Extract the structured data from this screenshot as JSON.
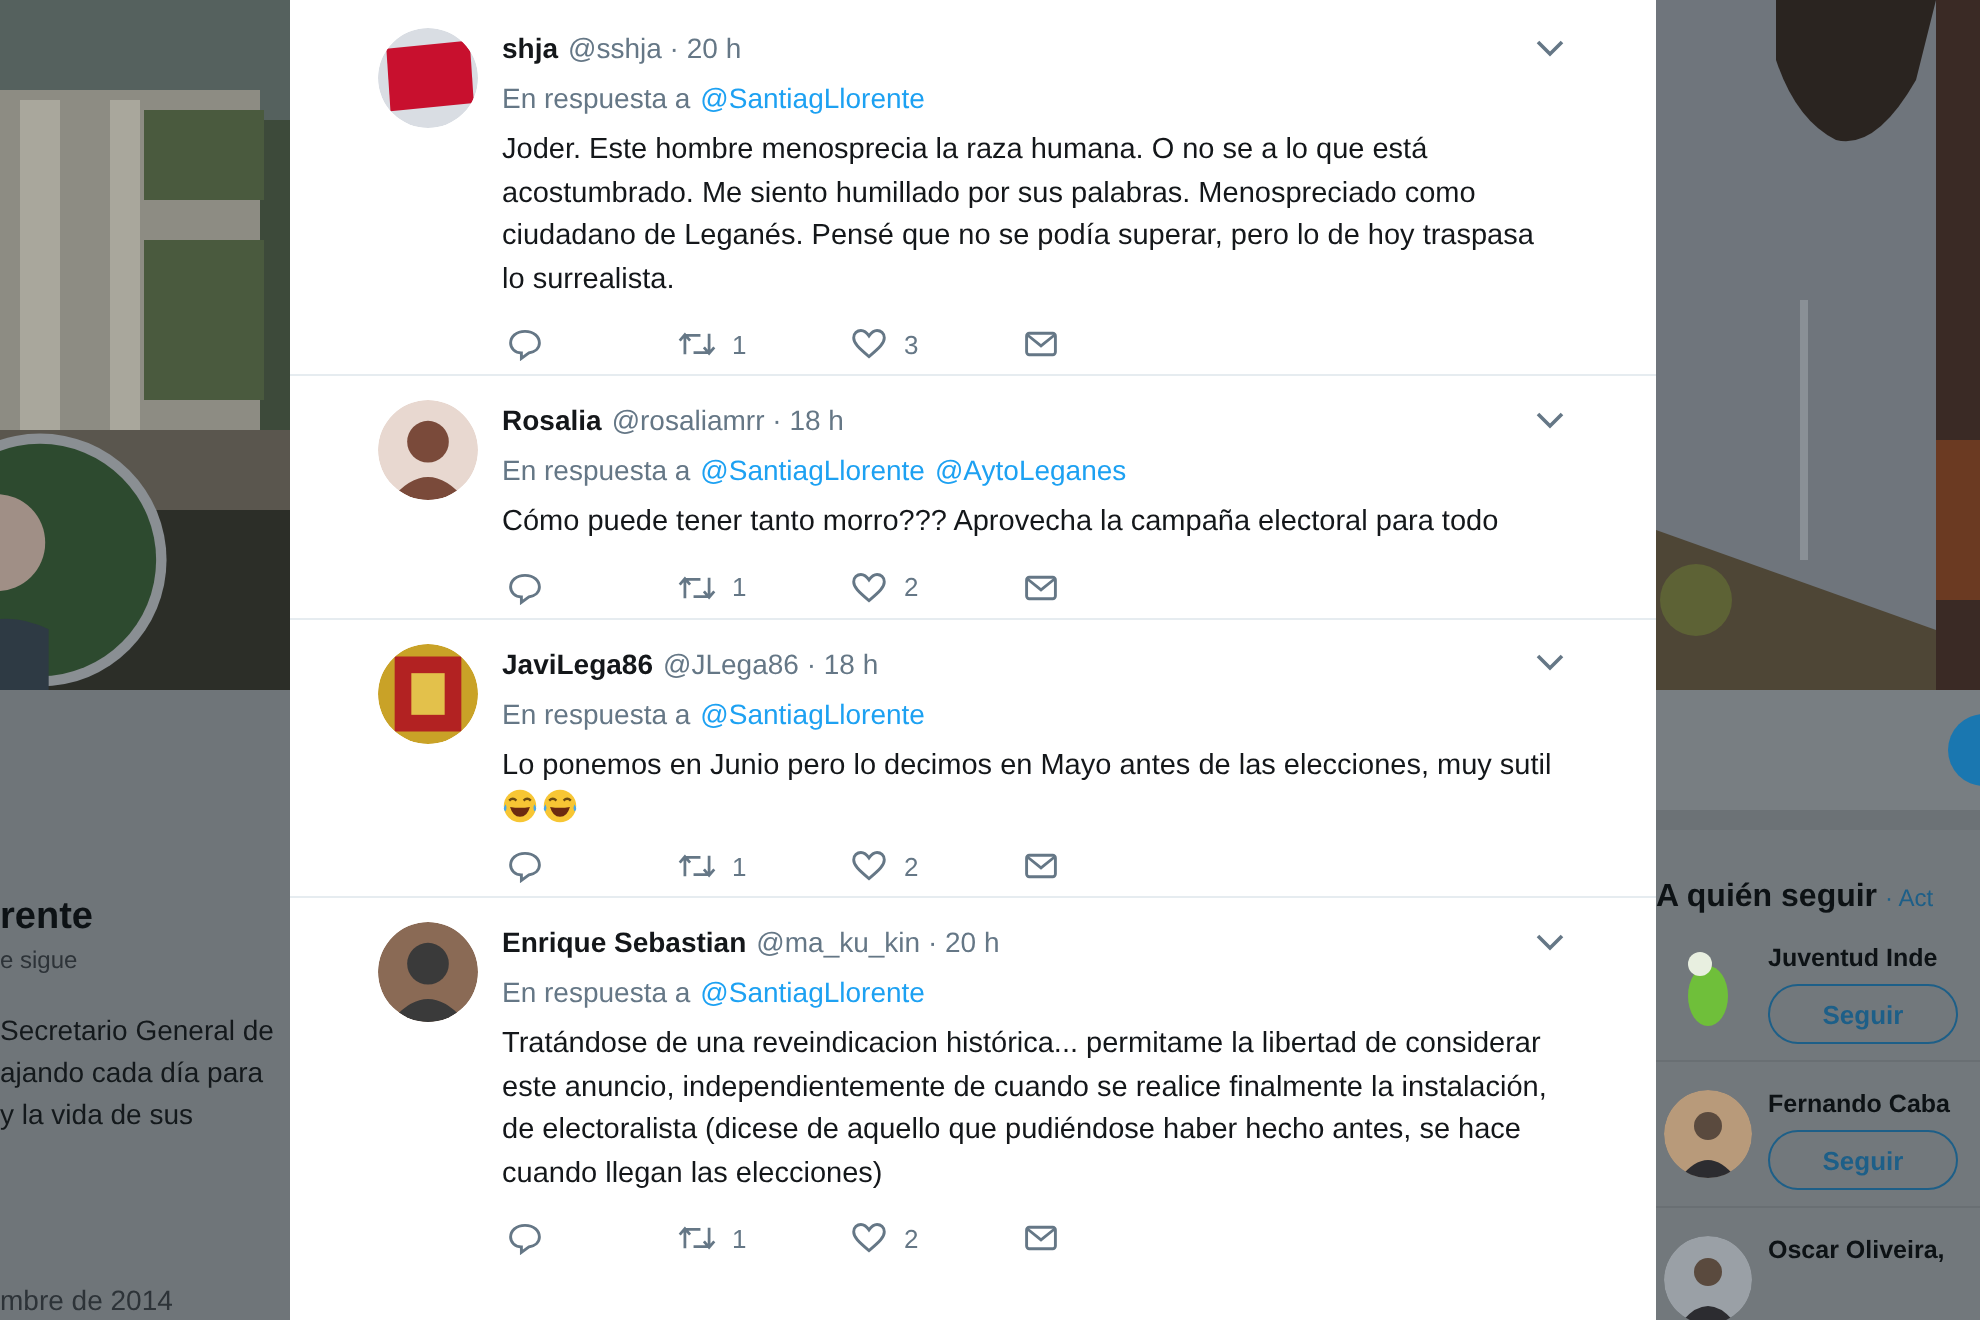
{
  "profile": {
    "name": "rente",
    "follows_you": "e sigue",
    "bio": [
      "Secretario General de",
      "ajando cada día para",
      "y la vida de sus"
    ],
    "joined": "mbre de 2014"
  },
  "replies": [
    {
      "name": "shja",
      "meta": "@sshja · 20 h",
      "reply_label": "En respuesta a",
      "mentions": [
        "@SantiagLlorente"
      ],
      "text": "Joder. Este hombre menosprecia la raza humana. O no se a lo que está acostumbrado. Me siento humillado por sus palabras. Menospreciado como ciudadano de Leganés. Pensé que no se podía superar, pero lo de hoy traspasa lo surrealista.",
      "retweets": "1",
      "likes": "3"
    },
    {
      "name": "Rosalia",
      "meta": "@rosaliamrr · 18 h",
      "reply_label": "En respuesta a",
      "mentions": [
        "@SantiagLlorente",
        "@AytoLeganes"
      ],
      "text": "Cómo puede tener tanto morro??? Aprovecha la campaña electoral para todo",
      "retweets": "1",
      "likes": "2"
    },
    {
      "name": "JaviLega86",
      "meta": "@JLega86 · 18 h",
      "reply_label": "En respuesta a",
      "mentions": [
        "@SantiagLlorente"
      ],
      "text": "Lo ponemos en Junio pero lo decimos en Mayo antes de las elecciones, muy sutil",
      "kind": "with-emoji-line",
      "retweets": "1",
      "likes": "2"
    },
    {
      "name": "Enrique Sebastian",
      "meta": "@ma_ku_kin · 20 h",
      "reply_label": "En respuesta a",
      "mentions": [
        "@SantiagLlorente"
      ],
      "text": "Tratándose de una reveindicacion histórica... permitame la libertad de considerar este anuncio, independientemente de cuando se realice finalmente la instalación, de electoralista (dicese de aquello que pudiéndose haber hecho antes, se hace cuando llegan las elecciones)",
      "retweets": "1",
      "likes": "2"
    }
  ],
  "who_to_follow": {
    "title": "A quién seguir",
    "link": "· Act",
    "suggestions": [
      {
        "name": "Juventud Inde",
        "button": "Seguir"
      },
      {
        "name": "Fernando Caba",
        "button": "Seguir"
      },
      {
        "name": "Oscar Oliveira,"
      }
    ]
  }
}
